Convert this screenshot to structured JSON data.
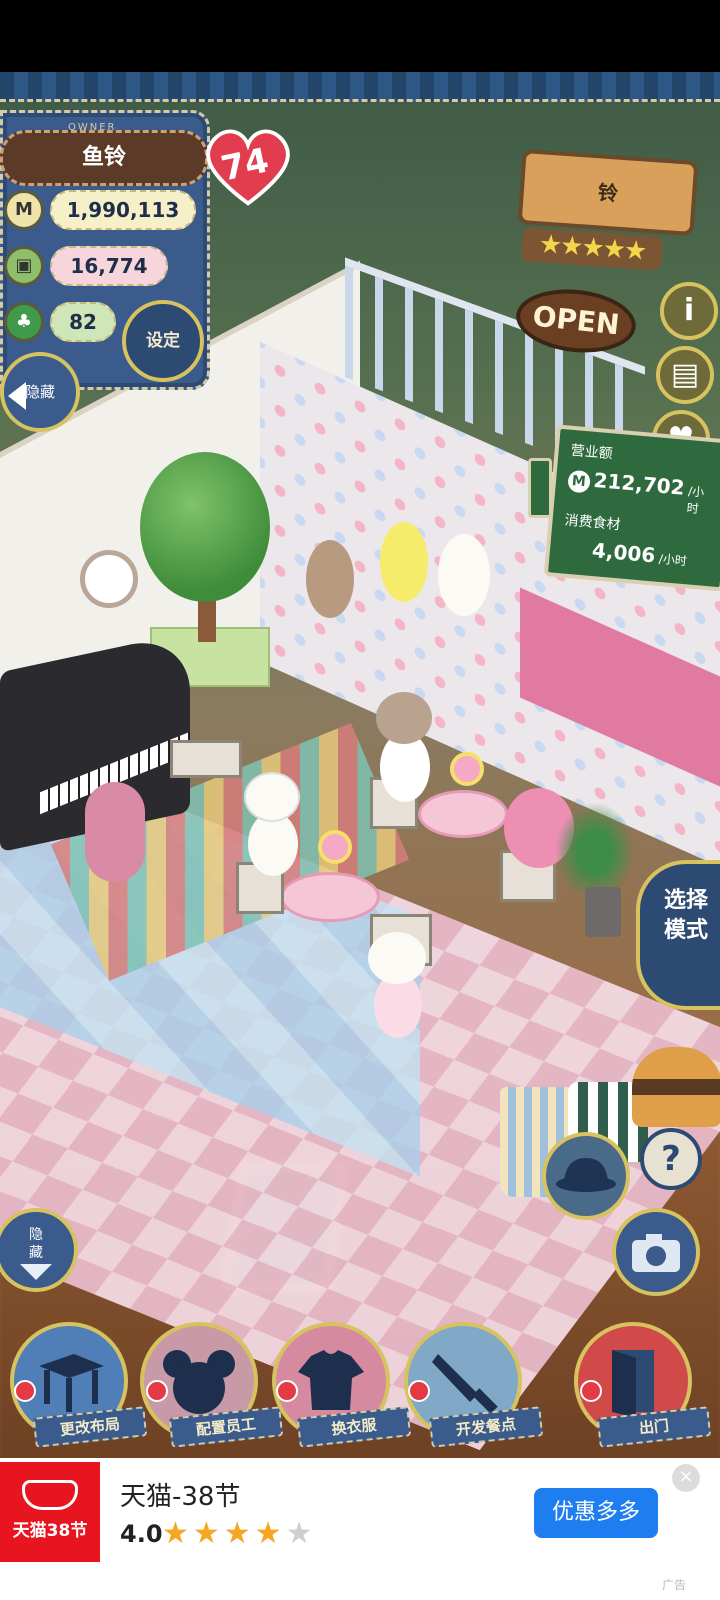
{
  "hud": {
    "owner_label": "OWNER",
    "owner_name": "鱼铃",
    "level": "74",
    "money": "1,990,113",
    "money_icon": "M",
    "ingredients": "16,774",
    "clover": "82",
    "settings_label": "设定",
    "hide_label": "隐藏"
  },
  "shop": {
    "sign_name": "铃",
    "stars": "★★★★★",
    "open_label": "OPEN"
  },
  "revenue": {
    "label": "营业额",
    "coin_icon": "M",
    "value": "212,702",
    "unit": "/小时",
    "ingredients_label": "消费食材",
    "ingredients_value": "4,006",
    "ingredients_unit": "/小时"
  },
  "side_buttons": [
    {
      "icon": "info-icon",
      "glyph": "i"
    },
    {
      "icon": "book-icon",
      "glyph": "▤"
    },
    {
      "icon": "heart-icon",
      "glyph": "♥"
    }
  ],
  "mode_button": {
    "line1": "选择",
    "line2": "模式"
  },
  "help_glyph": "?",
  "hide_bottom": {
    "line1": "隐",
    "line2": "藏"
  },
  "bottom_menu": [
    {
      "label": "更改布局",
      "icon": "table-icon",
      "color": "#4f7fb6"
    },
    {
      "label": "配置员工",
      "icon": "mouse-icon",
      "color": "#c89aa8"
    },
    {
      "label": "换衣服",
      "icon": "shirt-icon",
      "color": "#d58aa0"
    },
    {
      "label": "开发餐点",
      "icon": "knife-icon",
      "color": "#7fa9c6"
    },
    {
      "label": "出门",
      "icon": "door-icon",
      "color": "#d04a4a"
    }
  ],
  "ad": {
    "logo_text": "天猫38节",
    "title": "天猫-38节",
    "rating": "4.0",
    "stars_on": "★★★★",
    "stars_off": "★",
    "cta": "优惠多多",
    "close": "×",
    "tag": "广告",
    "brand_color": "#e8141f",
    "cta_color": "#1e7ef0"
  }
}
